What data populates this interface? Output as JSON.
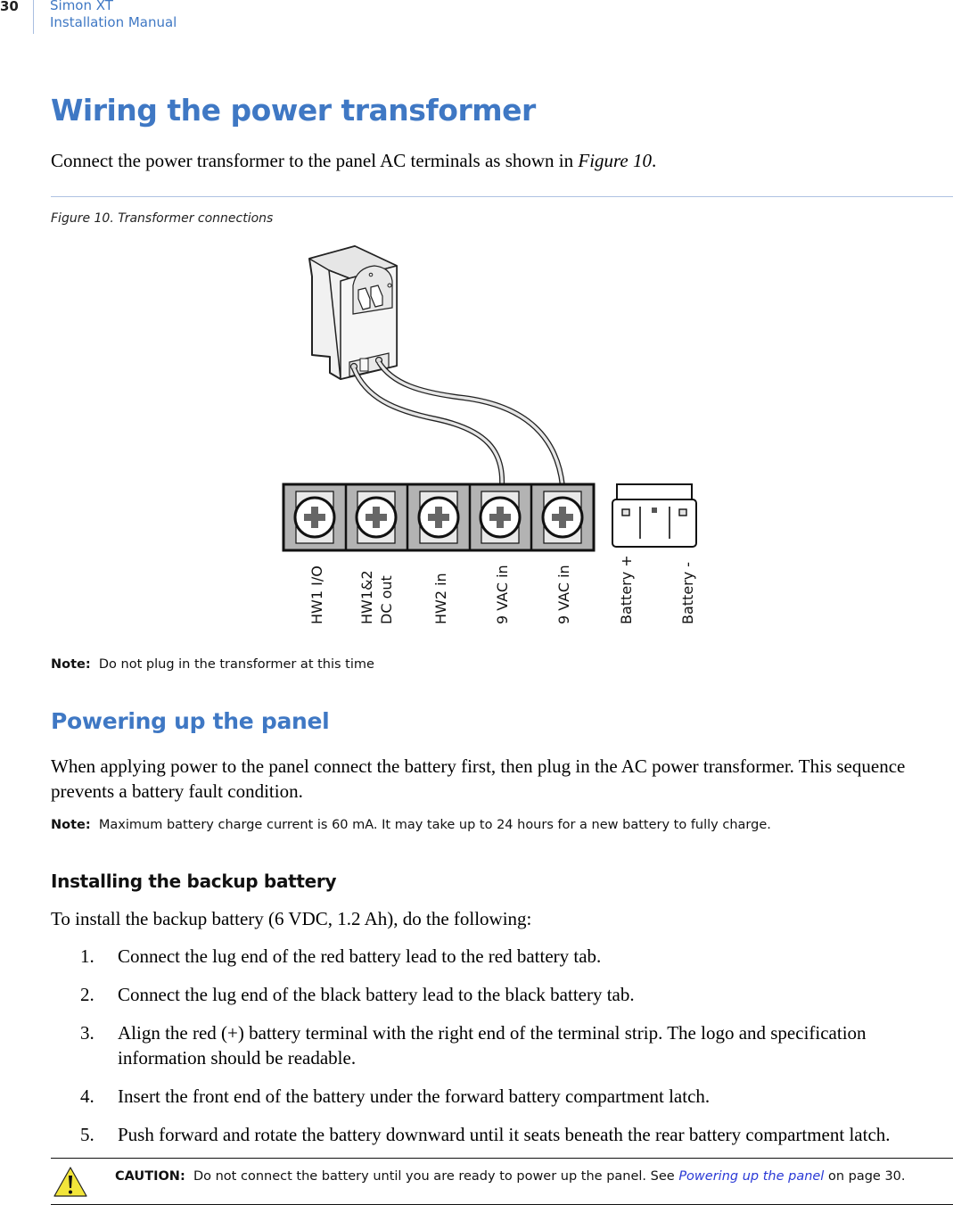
{
  "header": {
    "page_number": "30",
    "title_line1": "Simon XT",
    "title_line2": "Installation Manual"
  },
  "section_wiring": {
    "heading": "Wiring the power transformer",
    "intro_text": "Connect the power transformer to the panel AC terminals as shown in ",
    "intro_ref": "Figure 10",
    "intro_end": ".",
    "figure_caption": "Figure 10. Transformer connections",
    "terminal_labels": [
      "HW1 I/O",
      "HW1&2",
      "DC out",
      "HW2 in",
      "9 VAC in",
      "9 VAC in",
      "Battery +",
      "Battery -"
    ],
    "note_label": "Note:",
    "note_text": "Do not plug in the transformer at this time"
  },
  "section_powering": {
    "heading": "Powering up the panel",
    "paragraph": "When applying power to the panel connect the battery first, then plug in the AC power transformer. This sequence prevents a battery fault condition.",
    "note_label": "Note:",
    "note_text": "Maximum battery charge current is 60 mA. It may take up to 24 hours for a new battery to fully charge."
  },
  "section_battery": {
    "heading": "Installing the backup battery",
    "intro": "To install the backup battery (6 VDC, 1.2 Ah), do the following:",
    "steps": [
      {
        "num": "1.",
        "text": "Connect the lug end of the red battery lead to the red battery tab."
      },
      {
        "num": "2.",
        "text": "Connect the lug end of the black battery lead to the black battery tab."
      },
      {
        "num": "3.",
        "text": "Align the red (+) battery terminal with the right end of the terminal strip. The logo and specification information should be readable."
      },
      {
        "num": "4.",
        "text": "Insert the front end of the battery under the forward battery compartment latch."
      },
      {
        "num": "5.",
        "text": "Push forward and rotate the battery downward until it seats beneath the rear battery compartment latch."
      }
    ]
  },
  "caution": {
    "label": "CAUTION:",
    "text": "Do not connect the battery until you are ready to power up the panel. See ",
    "link_text": "Powering up the panel",
    "text_end": " on page 30."
  },
  "colors": {
    "heading_blue": "#3f78c4",
    "link_blue": "#2a39d6",
    "caution_yellow": "#f2e53a"
  }
}
